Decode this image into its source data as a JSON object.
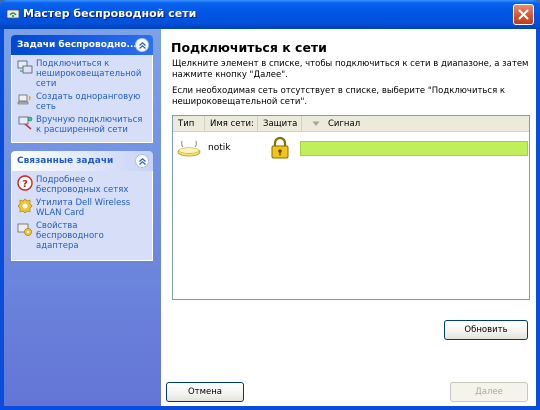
{
  "window": {
    "title": "Мастер беспроводной сети"
  },
  "sidebar": {
    "tasks_box": {
      "title": "Задачи беспроводно...",
      "items": [
        {
          "label": "Подключиться к нешироковещательной сети",
          "icon": "network-connect-icon"
        },
        {
          "label": "Создать одноранговую сеть",
          "icon": "adhoc-network-icon"
        },
        {
          "label": "Вручную подключиться к расширенной сети",
          "icon": "manual-connect-icon"
        }
      ]
    },
    "related_box": {
      "title": "Связанные задачи",
      "items": [
        {
          "label": "Подробнее о беспроводных сетях",
          "icon": "help-icon"
        },
        {
          "label": "Утилита Dell Wireless WLAN Card",
          "icon": "wlan-utility-icon"
        },
        {
          "label": "Свойства беспроводного адаптера",
          "icon": "adapter-properties-icon"
        }
      ]
    }
  },
  "main": {
    "title": "Подключиться к сети",
    "instruction1": "Щелкните элемент в списке, чтобы подключиться к сети в диапазоне, а затем нажмите кнопку \"Далее\".",
    "instruction2": "Если необходимая сеть отсутствует в списке, выберите \"Подключиться к нешироковещательной сети\".",
    "columns": [
      "Тип",
      "Имя сети:",
      "Защита",
      "Сигнал"
    ],
    "networks": [
      {
        "name": "notik",
        "secured": true,
        "signal": 1.0
      }
    ]
  },
  "buttons": {
    "refresh": "Обновить",
    "cancel": "Отмена",
    "next": "Далее"
  },
  "colors": {
    "signal_bar": "#c1ef5a",
    "titlebar": "#0055e5",
    "sidebar_link": "#215dc6"
  }
}
